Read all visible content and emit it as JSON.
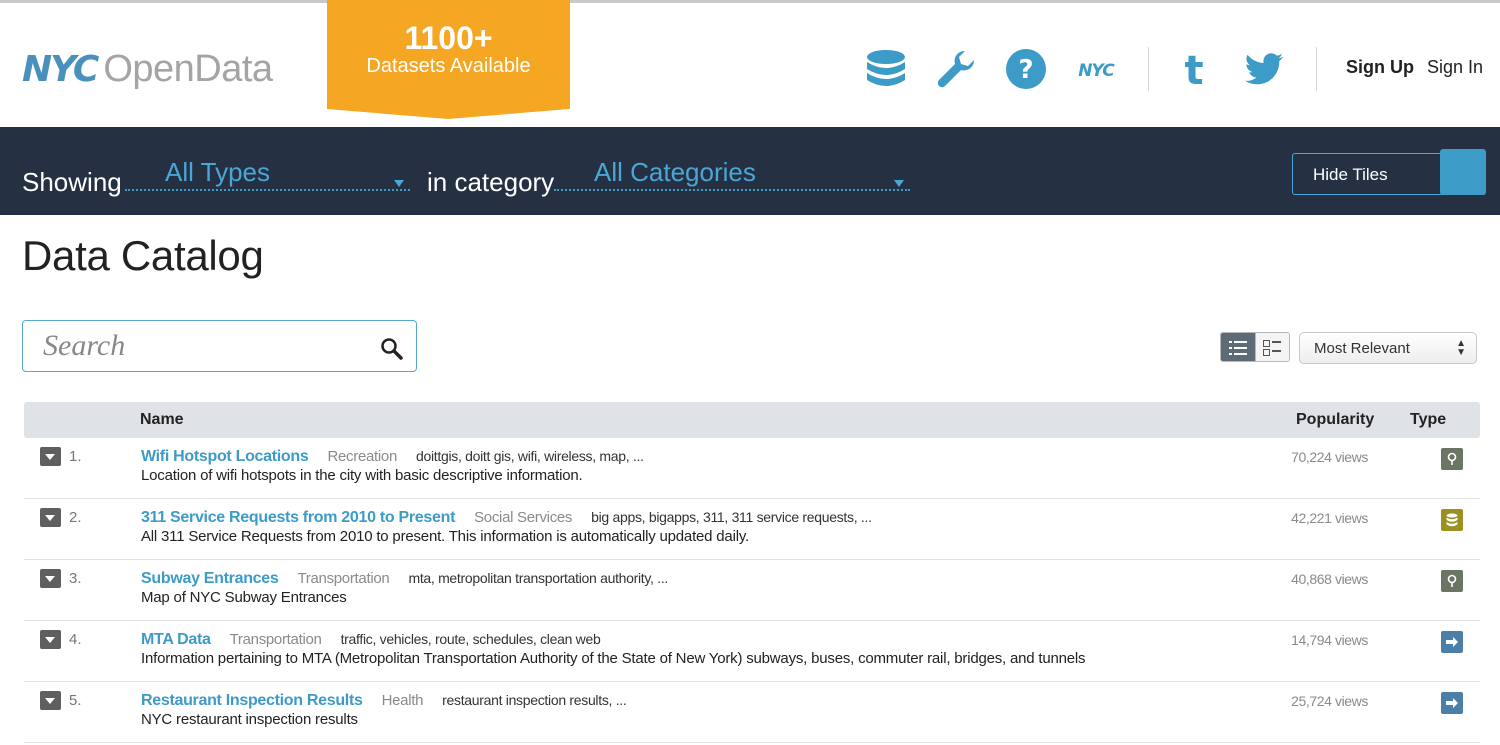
{
  "header": {
    "logo_nyc": "NYC",
    "logo_opendata": "OpenData",
    "banner_count": "1100+",
    "banner_text": "Datasets Available",
    "icons": [
      "database-icon",
      "wrench-icon",
      "help-icon",
      "nyc-icon",
      "tumblr-icon",
      "twitter-icon"
    ],
    "sign_up": "Sign Up",
    "sign_in": "Sign In",
    "accent_color": "#3d9bc7",
    "banner_color": "#f5a623"
  },
  "filter": {
    "showing_label": "Showing",
    "type_value": "All Types",
    "category_label": "in category",
    "category_value": "All Categories",
    "hide_tiles_label": "Hide Tiles",
    "bar_color": "#253142"
  },
  "catalog": {
    "title": "Data Catalog",
    "search_placeholder": "Search",
    "sort_value": "Most Relevant",
    "columns": {
      "name": "Name",
      "popularity": "Popularity",
      "type": "Type"
    },
    "rows": [
      {
        "num": "1.",
        "title": "Wifi Hotspot Locations",
        "category": "Recreation",
        "tags": "doittgis, doitt gis, wifi, wireless, map, ...",
        "desc": "Location of wifi hotspots in the city with basic descriptive information.",
        "views": "70,224 views",
        "type_icon": "map-pin-icon",
        "type_color": "#6b7564"
      },
      {
        "num": "2.",
        "title": "311 Service Requests from 2010 to Present",
        "category": "Social Services",
        "tags": "big apps, bigapps, 311, 311 service requests, ...",
        "desc": "All 311 Service Requests from 2010 to present. This information is automatically updated daily.",
        "views": "42,221 views",
        "type_icon": "dataset-icon",
        "type_color": "#9a9120"
      },
      {
        "num": "3.",
        "title": "Subway Entrances",
        "category": "Transportation",
        "tags": "mta, metropolitan transportation authority, ...",
        "desc": "Map of NYC Subway Entrances",
        "views": "40,868 views",
        "type_icon": "map-pin-icon",
        "type_color": "#6b7564"
      },
      {
        "num": "4.",
        "title": "MTA Data",
        "category": "Transportation",
        "tags": "traffic, vehicles, route, schedules, clean web",
        "desc": "Information pertaining to MTA (Metropolitan Transportation Authority of the State of New York) subways, buses, commuter rail, bridges, and tunnels",
        "views": "14,794 views",
        "type_icon": "external-link-icon",
        "type_color": "#4b7fa8"
      },
      {
        "num": "5.",
        "title": "Restaurant Inspection Results",
        "category": "Health",
        "tags": "restaurant inspection results, ...",
        "desc": "NYC restaurant inspection results",
        "views": "25,724 views",
        "type_icon": "external-link-icon",
        "type_color": "#4b7fa8"
      }
    ]
  }
}
